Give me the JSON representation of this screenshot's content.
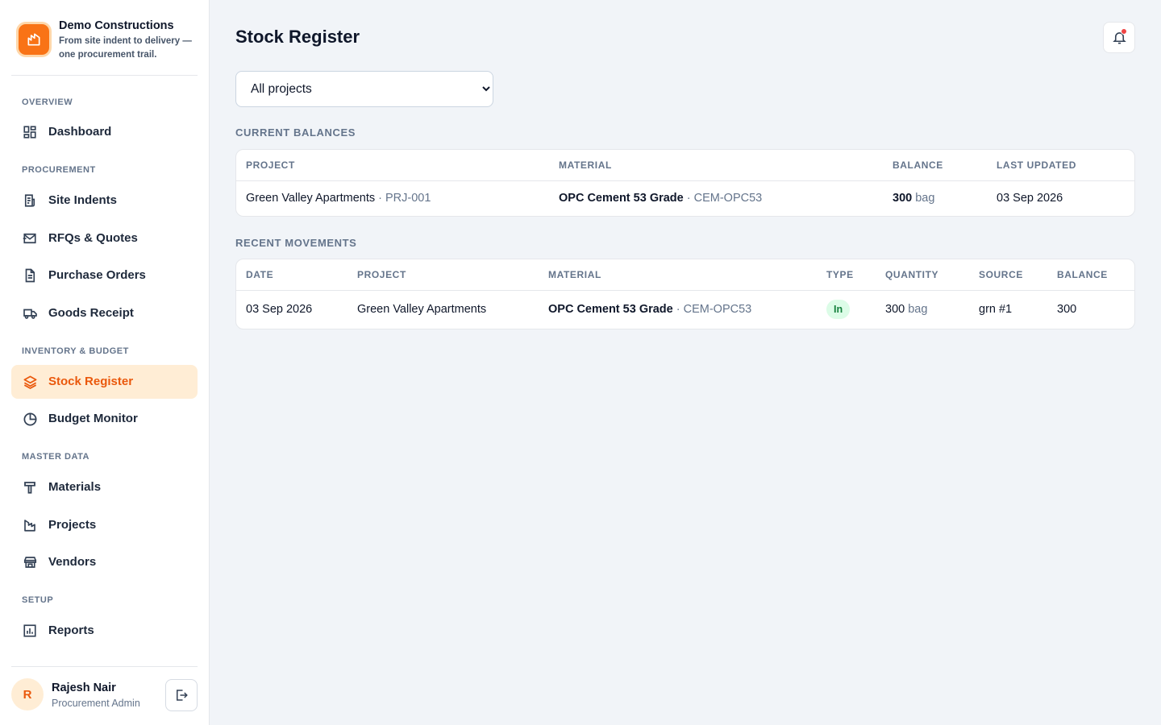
{
  "brand": {
    "name": "Demo Constructions",
    "tagline": "From site indent to delivery — one procurement trail."
  },
  "sidebar": {
    "sections": {
      "overview": "Overview",
      "procurement": "Procurement",
      "inventory": "Inventory & Budget",
      "master": "Master Data",
      "setup": "Setup"
    },
    "items": {
      "dashboard": "Dashboard",
      "site_indents": "Site Indents",
      "rfqs": "RFQs & Quotes",
      "purchase_orders": "Purchase Orders",
      "goods_receipt": "Goods Receipt",
      "stock_register": "Stock Register",
      "budget_monitor": "Budget Monitor",
      "materials": "Materials",
      "projects": "Projects",
      "vendors": "Vendors",
      "reports": "Reports"
    },
    "active": "stock_register",
    "accent": "#ea580c"
  },
  "user": {
    "initial": "R",
    "name": "Rajesh Nair",
    "role": "Procurement Admin"
  },
  "header": {
    "title": "Stock Register",
    "notification_icon": "bell-icon"
  },
  "filter": {
    "selected": "All projects"
  },
  "balances": {
    "label": "Current Balances",
    "columns": [
      "Project",
      "Material",
      "Balance",
      "Last Updated"
    ],
    "rows": [
      {
        "project": "Green Valley Apartments",
        "project_code": "· PRJ-001",
        "material": "OPC Cement 53 Grade",
        "material_code": "· CEM-OPC53",
        "balance": "300",
        "unit": "bag",
        "updated": "03 Sep 2026"
      }
    ]
  },
  "movements": {
    "label": "Recent Movements",
    "columns": [
      "Date",
      "Project",
      "Material",
      "Type",
      "Quantity",
      "Source",
      "Balance"
    ],
    "rows": [
      {
        "date": "03 Sep 2026",
        "project": "Green Valley Apartments",
        "material": "OPC Cement 53 Grade",
        "material_code": "· CEM-OPC53",
        "type": "In",
        "quantity": "300",
        "unit": "bag",
        "source": "grn #1",
        "balance": "300"
      }
    ]
  }
}
